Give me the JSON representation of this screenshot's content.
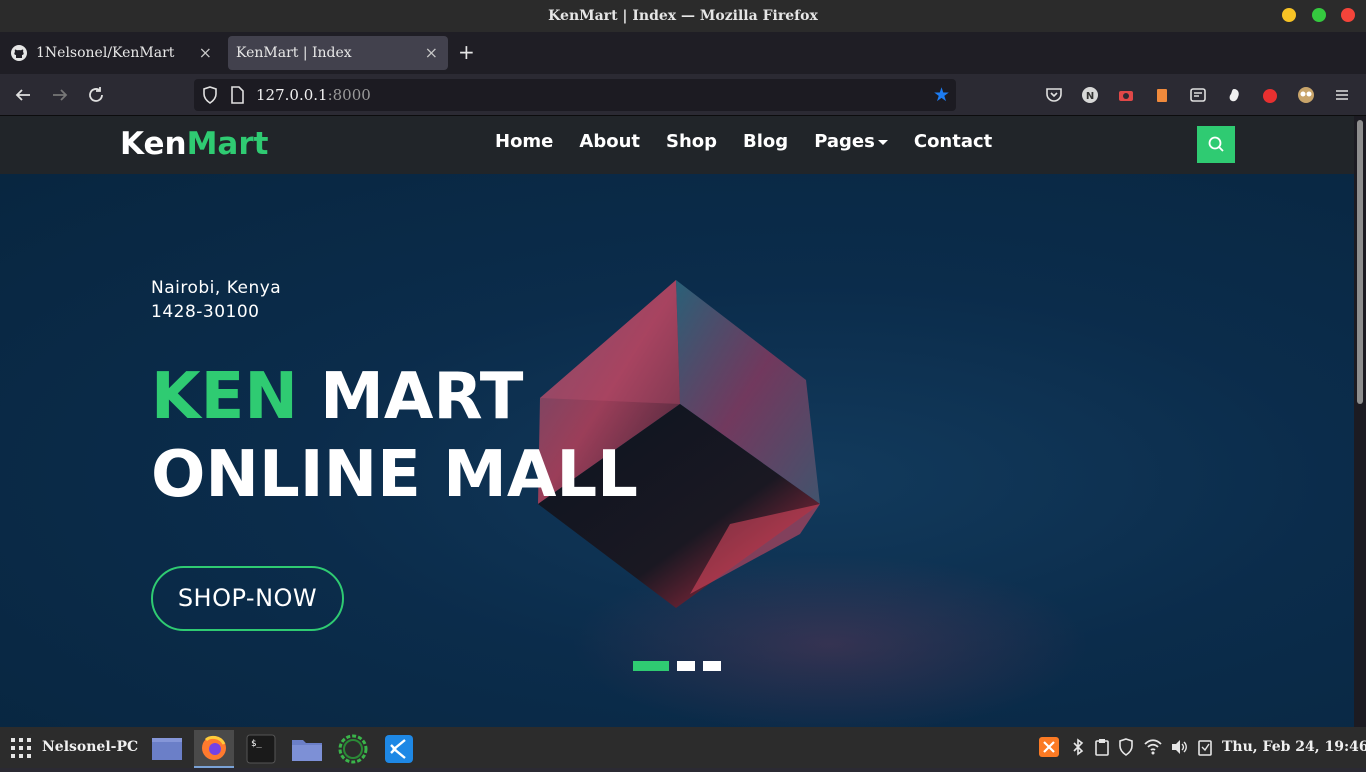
{
  "window": {
    "title": "KenMart | Index — Mozilla Firefox"
  },
  "tabs": [
    {
      "label": "1Nelsonel/KenMart",
      "active": false
    },
    {
      "label": "KenMart | Index",
      "active": true
    }
  ],
  "urlbar": {
    "host": "127.0.0.1",
    "port": ":8000"
  },
  "site": {
    "brand_part1": "Ken",
    "brand_part2": "Mart",
    "nav": [
      "Home",
      "About",
      "Shop",
      "Blog",
      "Pages",
      "Contact"
    ],
    "accent_color": "#2fcb72"
  },
  "hero": {
    "address_line1": "Nairobi, Kenya",
    "address_line2": "1428-30100",
    "headline_green": "KEN",
    "headline_white": "MART",
    "headline_line2": "ONLINE MALL",
    "cta": "SHOP-NOW",
    "carousel": {
      "slides": 3,
      "active": 1
    }
  },
  "taskbar": {
    "hostname": "Nelsonel-PC",
    "clock": "Thu, Feb 24, 19:46",
    "apps": [
      "files-icon",
      "firefox-icon",
      "terminal-icon",
      "folder-icon",
      "system-monitor-icon",
      "vscode-icon"
    ]
  }
}
